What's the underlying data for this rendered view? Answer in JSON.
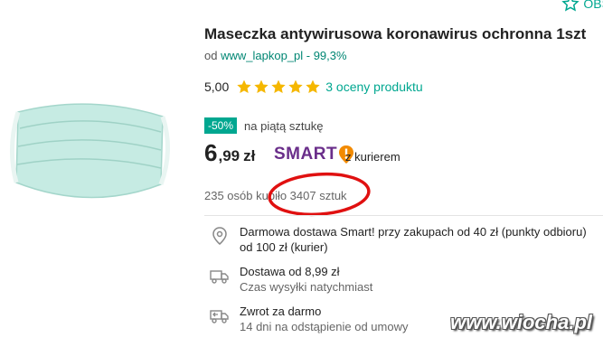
{
  "header": {
    "observe_label": "OBS"
  },
  "product": {
    "title": "Maseczka antywirusowa koronawirus ochronna 1szt",
    "seller_prefix": "od",
    "seller_name": "www_lapkop_pl - 99,3%",
    "rating_value": "5,00",
    "rating_stars": 5,
    "rating_link": "3 oceny produktu",
    "discount_badge": "-50%",
    "discount_text": "na piątą sztukę",
    "price_main": "6",
    "price_decimal": ",99",
    "price_currency": "zł",
    "smart_label": "SMART",
    "courier_text": "z kurierem",
    "purchased_text": "235 osób kupiło 3407 sztuk"
  },
  "delivery": [
    {
      "icon": "map-pin-icon",
      "main": "Darmowa dostawa Smart! przy zakupach od 40 zł (punkty odbioru)",
      "main2": "od 100 zł (kurier)",
      "sub": ""
    },
    {
      "icon": "truck-icon",
      "main": "Dostawa od 8,99 zł",
      "main2": "",
      "sub": "Czas wysyłki natychmiast"
    },
    {
      "icon": "return-truck-icon",
      "main": "Zwrot za darmo",
      "main2": "",
      "sub": "14 dni na odstąpienie od umowy"
    }
  ],
  "watermark": "www.wiocha.pl",
  "colors": {
    "accent": "#00a790",
    "smart": "#6a2e8a",
    "star": "#f5b700",
    "highlight_circle": "#e01010"
  }
}
